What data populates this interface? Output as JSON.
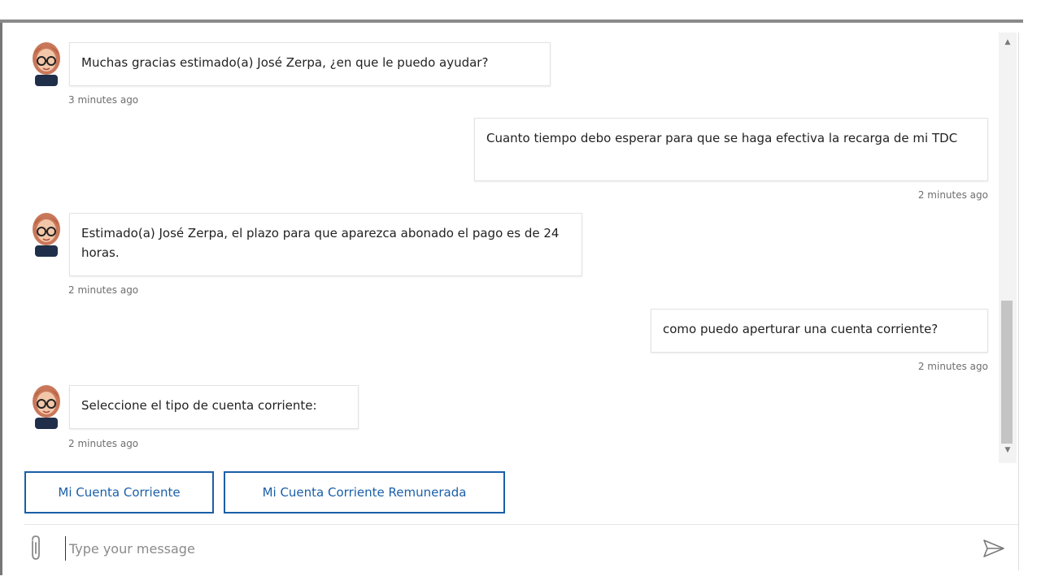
{
  "messages": [
    {
      "from": "bot",
      "text": "Muchas gracias estimado(a) José Zerpa, ¿en que le puedo ayudar?",
      "time": "3 minutes ago"
    },
    {
      "from": "user",
      "text": "Cuanto tiempo debo esperar para que se haga efectiva la recarga de mi TDC",
      "time": "2 minutes ago"
    },
    {
      "from": "bot",
      "text": "Estimado(a) José Zerpa, el plazo para que aparezca abonado el pago es de 24 horas.",
      "time": "2 minutes ago"
    },
    {
      "from": "user",
      "text": "como puedo aperturar una cuenta corriente?",
      "time": "2 minutes ago"
    },
    {
      "from": "bot",
      "text": "Seleccione el tipo de cuenta corriente:",
      "time": "2 minutes ago"
    }
  ],
  "quick_replies": [
    {
      "label": "Mi Cuenta Corriente"
    },
    {
      "label": "Mi Cuenta Corriente Remunerada"
    }
  ],
  "input": {
    "placeholder": "Type your message",
    "value": ""
  },
  "icons": {
    "attach": "paperclip-icon",
    "send": "send-icon",
    "avatar": "bot-avatar-icon",
    "scroll_up": "scroll-up-arrow-icon",
    "scroll_down": "scroll-down-arrow-icon"
  },
  "colors": {
    "accent": "#1a5fa8",
    "timestamp": "#6e6e6e",
    "bubble_border": "#e3e3e3"
  }
}
